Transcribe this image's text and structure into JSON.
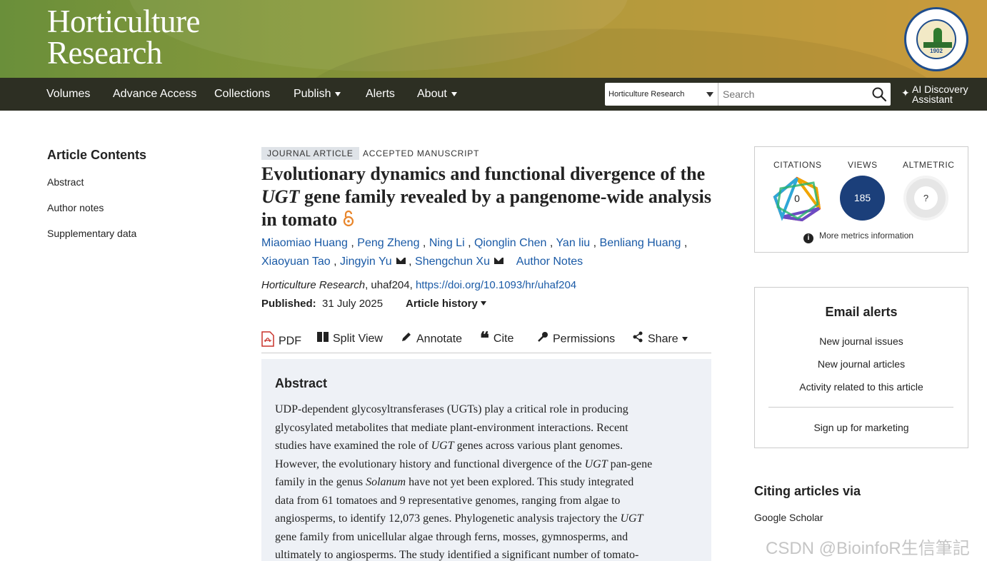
{
  "header": {
    "journal_name_line1": "Horticulture",
    "journal_name_line2": "Research",
    "seal_year": "1902",
    "seal_label": "NANJING AGRICULTURAL UNIVERSITY"
  },
  "nav": {
    "items": [
      {
        "label": "Volumes"
      },
      {
        "label": "Advance Access"
      },
      {
        "label": "Collections"
      },
      {
        "label": "Publish"
      },
      {
        "label": "Alerts"
      },
      {
        "label": "About"
      }
    ],
    "search_scope": "Horticulture Research",
    "search_placeholder": "Search",
    "ai_line1": "AI Discovery",
    "ai_line2": "Assistant"
  },
  "sidebar": {
    "title": "Article Contents",
    "items": [
      {
        "label": "Abstract"
      },
      {
        "label": "Author notes"
      },
      {
        "label": "Supplementary data"
      }
    ]
  },
  "article": {
    "type_tag": "JOURNAL ARTICLE",
    "status_tag": "ACCEPTED MANUSCRIPT",
    "title_part1": "Evolutionary dynamics and functional divergence of the ",
    "title_italic": "UGT",
    "title_part2": " gene family revealed by a pangenome-wide analysis in tomato",
    "authors": [
      "Miaomiao Huang",
      "Peng Zheng",
      "Ning Li",
      "Qionglin Chen",
      "Yan liu",
      "Benliang Huang",
      "Xiaoyuan Tao",
      "Jingyin Yu",
      "Shengchun Xu"
    ],
    "author_notes": "Author Notes",
    "journal": "Horticulture Research",
    "article_id": ", uhaf204, ",
    "doi": "https://doi.org/10.1093/hr/uhaf204",
    "published_label": "Published:",
    "published_date": "31 July 2025",
    "history_label": "Article history"
  },
  "toolbar": {
    "pdf": "PDF",
    "split": "Split View",
    "annotate": "Annotate",
    "cite": "Cite",
    "permissions": "Permissions",
    "share": "Share"
  },
  "abstract": {
    "title": "Abstract",
    "lines": [
      "UDP-dependent glycosyltransferases (UGTs) play a critical role in producing",
      "glycosylated metabolites that mediate plant-environment interactions. Recent",
      [
        "studies have examined the role of ",
        "UGT",
        " genes across various plant genomes."
      ],
      [
        "However, the evolutionary history and functional divergence of the ",
        "UGT",
        " pan-gene"
      ],
      [
        "family in the genus ",
        "Solanum",
        " have not yet been explored. This study integrated"
      ],
      "data from 61 tomatoes and 9 representative genomes, ranging from algae to",
      [
        "angiosperms, to identify 12,073 genes. Phylogenetic analysis trajectory the ",
        "UGT",
        ""
      ],
      "gene family from unicellular algae through ferns, mosses, gymnosperms, and",
      "ultimately to angiosperms. The study identified a significant number of tomato-"
    ]
  },
  "metrics": {
    "citations_label": "CITATIONS",
    "citations_value": "0",
    "views_label": "VIEWS",
    "views_value": "185",
    "altmetric_label": "ALTMETRIC",
    "altmetric_value": "?",
    "more": "More metrics information"
  },
  "alerts": {
    "title": "Email alerts",
    "items": [
      "New journal issues",
      "New journal articles",
      "Activity related to this article"
    ],
    "marketing": "Sign up for marketing"
  },
  "citing": {
    "title": "Citing articles via",
    "link": "Google Scholar"
  },
  "watermark": "CSDN @BioinfoR生信筆記",
  "colors": {
    "nav_bg": "#2d2f23",
    "link": "#1a5aa6",
    "views_circle": "#1b3f7a",
    "abstract_bg": "#eef1f6"
  }
}
